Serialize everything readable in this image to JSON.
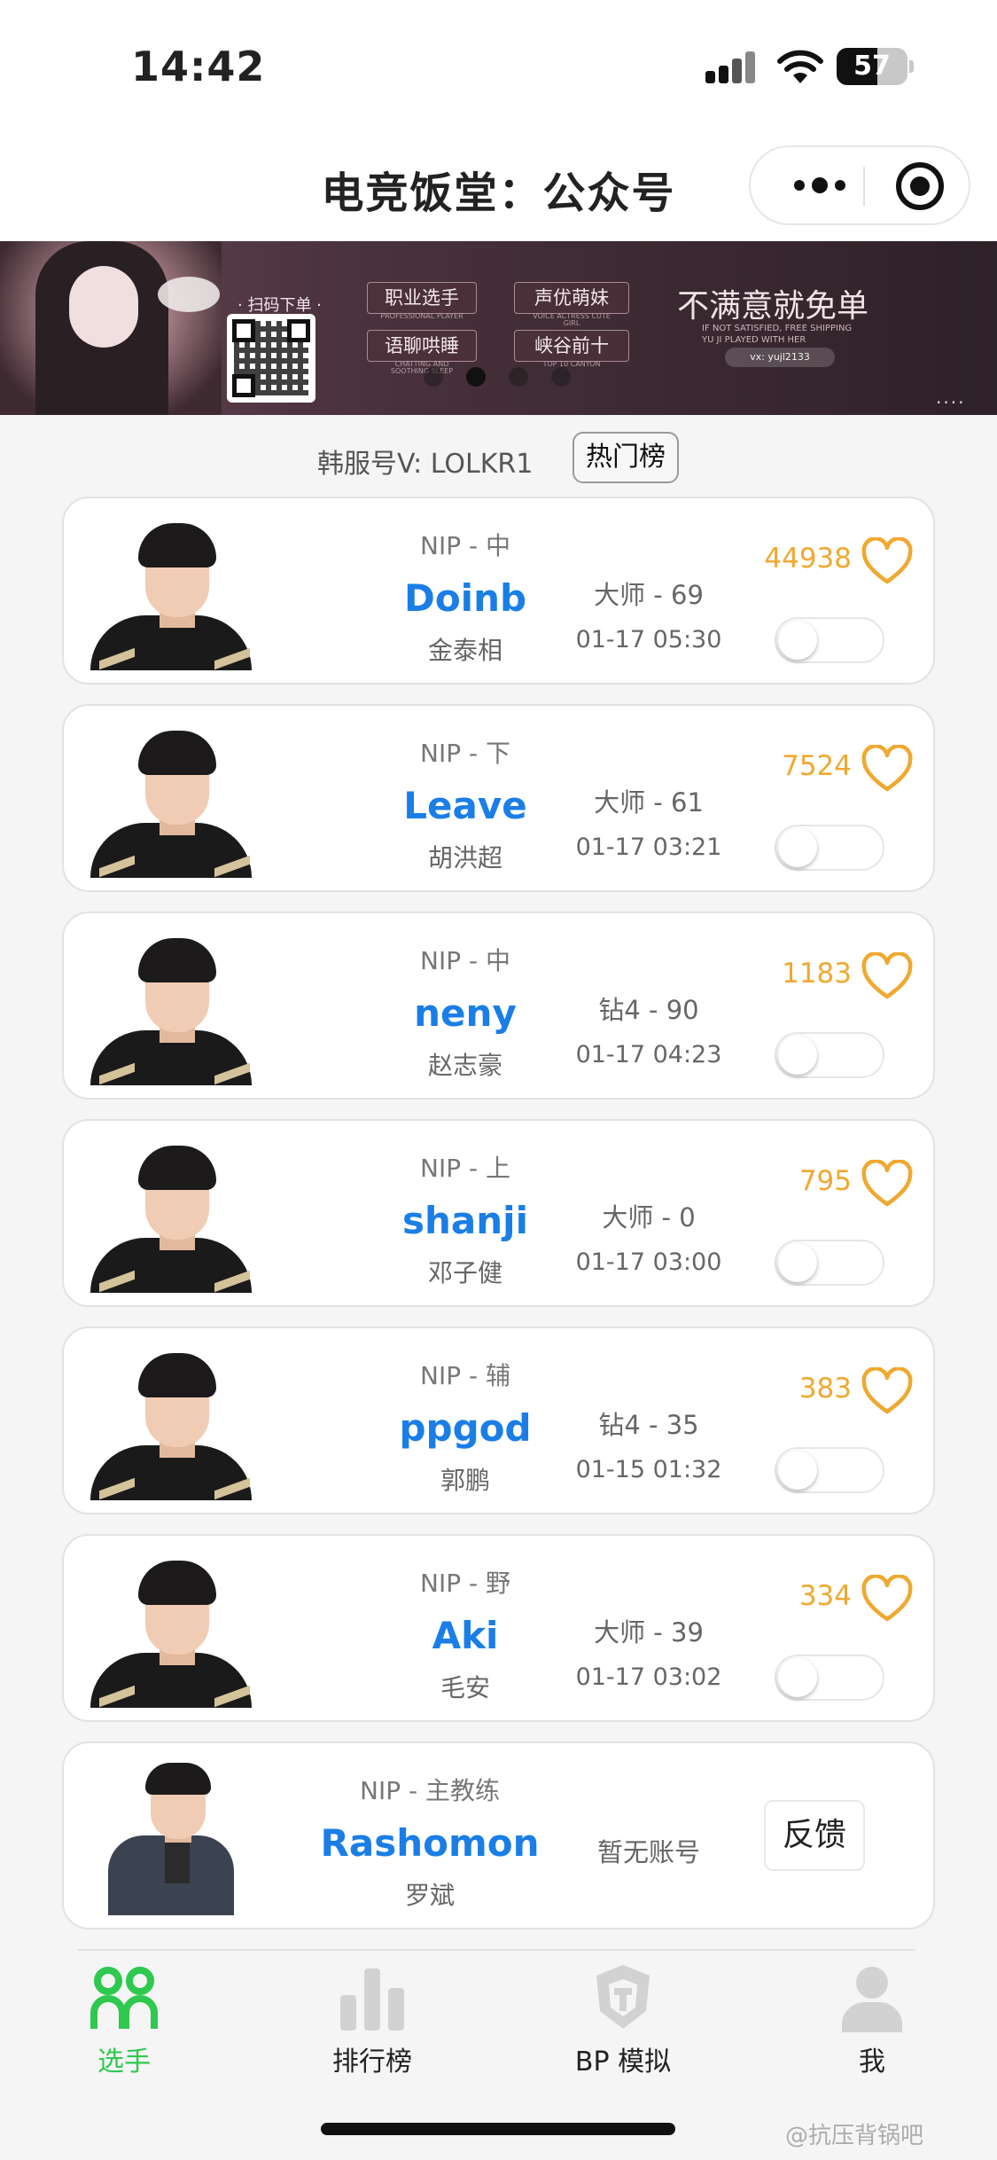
{
  "status_bar": {
    "time": "14:42",
    "battery": "57",
    "battery_level": 0.57
  },
  "nav": {
    "title": "电竞饭堂：公众号"
  },
  "banner": {
    "scan_label": "· 扫码下单 ·",
    "pills": [
      {
        "label": "职业选手",
        "sub": "PROFESSIONAL PLAYER"
      },
      {
        "label": "声优萌妹",
        "sub": "VOICE ACTRESS CUTE GIRL"
      },
      {
        "label": "语聊哄睡",
        "sub": "CHATTING AND SOOTHING SLEEP"
      },
      {
        "label": "峡谷前十",
        "sub": "TOP 10 CANYON"
      }
    ],
    "slogan": "不满意就免单",
    "subtitle_1": "IF NOT SATISFIED, FREE SHIPPING",
    "subtitle_2": "YU JI PLAYED WITH HER",
    "wx": "vx: yujl2133",
    "more": "····",
    "active_slide": 2,
    "slide_count": 4
  },
  "info": {
    "server_text": "韩服号V: LOLKR1",
    "hot_button": "热门榜"
  },
  "players": [
    {
      "team_role": "NIP - 中",
      "name": "Doinb",
      "real_name": "金泰相",
      "rank": "大师 - 69",
      "updated": "01-17 05:30",
      "likes": "44938",
      "subscribed": false
    },
    {
      "team_role": "NIP - 下",
      "name": "Leave",
      "real_name": "胡洪超",
      "rank": "大师 - 61",
      "updated": "01-17 03:21",
      "likes": "7524",
      "subscribed": false
    },
    {
      "team_role": "NIP - 中",
      "name": "neny",
      "real_name": "赵志豪",
      "rank": "钻4 - 90",
      "updated": "01-17 04:23",
      "likes": "1183",
      "subscribed": false
    },
    {
      "team_role": "NIP - 上",
      "name": "shanji",
      "real_name": "邓子健",
      "rank": "大师 - 0",
      "updated": "01-17 03:00",
      "likes": "795",
      "subscribed": false
    },
    {
      "team_role": "NIP - 辅",
      "name": "ppgod",
      "real_name": "郭鹏",
      "rank": "钻4 - 35",
      "updated": "01-15 01:32",
      "likes": "383",
      "subscribed": false
    },
    {
      "team_role": "NIP - 野",
      "name": "Aki",
      "real_name": "毛安",
      "rank": "大师 - 39",
      "updated": "01-17 03:02",
      "likes": "334",
      "subscribed": false
    }
  ],
  "coach": {
    "team_role": "NIP - 主教练",
    "name": "Rashomon",
    "real_name": "罗斌",
    "status": "暂无账号",
    "feedback": "反馈"
  },
  "tabs": [
    {
      "label": "选手",
      "icon": "players-icon",
      "active": true
    },
    {
      "label": "排行榜",
      "icon": "bar-chart-icon",
      "active": false
    },
    {
      "label": "BP 模拟",
      "icon": "helmet-icon",
      "active": false
    },
    {
      "label": "我",
      "icon": "user-icon",
      "active": false
    }
  ],
  "watermark": "@抗压背锅吧",
  "colors": {
    "accent_blue": "#1a7ee6",
    "likes_orange": "#f0a830",
    "active_green": "#2ec94e"
  }
}
